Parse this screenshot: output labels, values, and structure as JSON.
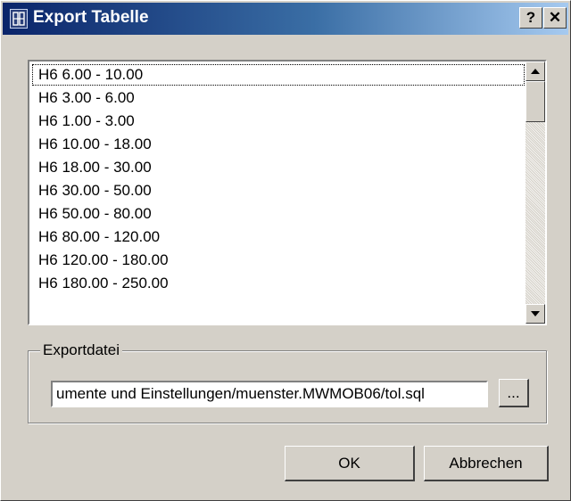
{
  "window": {
    "title": "Export Tabelle",
    "help_label": "?",
    "close_label": "✕"
  },
  "list": {
    "items": [
      "H6  6.00 - 10.00",
      "H6  3.00 - 6.00",
      "H6  1.00 - 3.00",
      "H6  10.00 - 18.00",
      "H6  18.00 - 30.00",
      "H6  30.00 - 50.00",
      "H6  50.00 - 80.00",
      "H6  80.00 - 120.00",
      "H6  120.00 - 180.00",
      "H6  180.00 - 250.00"
    ],
    "focused_index": 0
  },
  "export": {
    "group_label": "Exportdatei",
    "path_value": "umente und Einstellungen/muenster.MWMOB06/tol.sql",
    "browse_label": "..."
  },
  "buttons": {
    "ok_label": "OK",
    "cancel_label": "Abbrechen"
  }
}
